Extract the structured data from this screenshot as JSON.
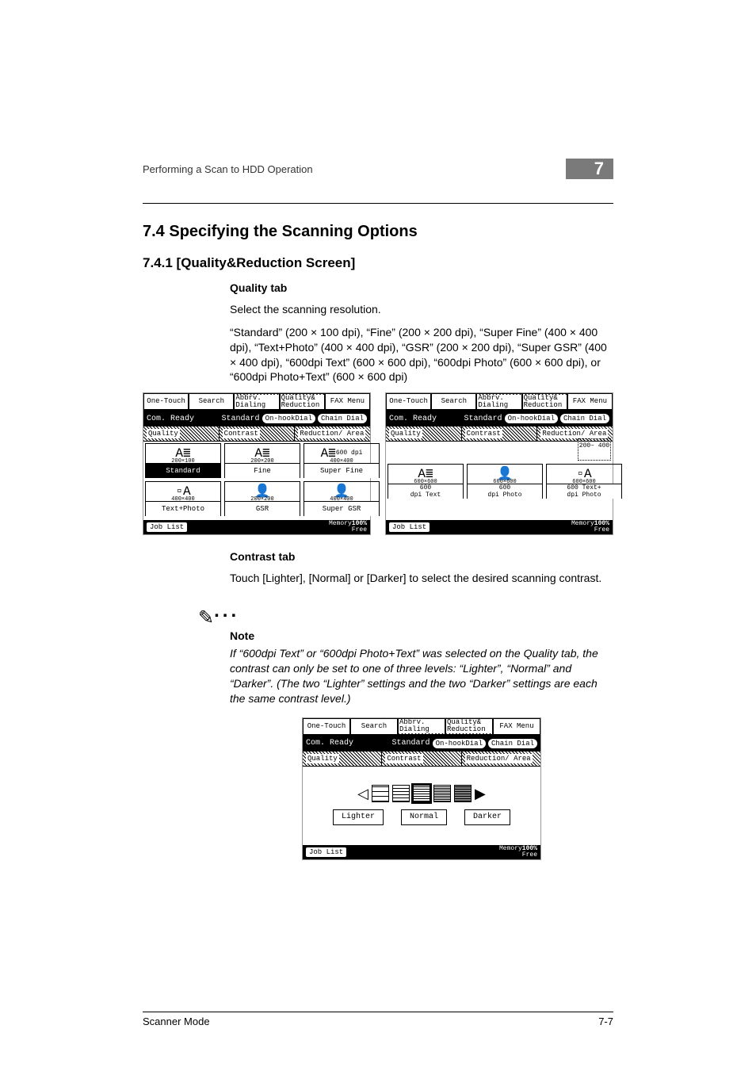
{
  "header": {
    "title": "Performing a Scan to HDD Operation",
    "chapter_number": "7"
  },
  "sec": {
    "number_title": "7.4    Specifying the Scanning Options",
    "sub_number_title": "7.4.1    [Quality&Reduction Screen]",
    "quality_head": "Quality tab",
    "quality_p1": "Select the scanning resolution.",
    "quality_p2": "“Standard” (200 × 100 dpi), “Fine” (200 × 200 dpi), “Super Fine” (400 × 400 dpi), “Text+Photo” (400 × 400 dpi), “GSR” (200 × 200 dpi), “Super GSR” (400 × 400 dpi), “600dpi Text” (600 × 600 dpi), “600dpi Photo” (600 × 600 dpi), or “600dpi Photo+Text” (600 × 600 dpi)",
    "contrast_head": "Contrast tab",
    "contrast_p1": "Touch [Lighter], [Normal] or [Darker] to select the desired scanning contrast.",
    "note_title": "Note",
    "note_body": "If “600dpi Text” or “600dpi Photo+Text” was selected on the Quality tab, the contrast can only be set to one of three levels: “Lighter”, “Normal” and “Darker”. (The two “Lighter” settings and the two “Darker” settings are each the same contrast level.)"
  },
  "lcd": {
    "tabs": {
      "one_touch": "One-Touch",
      "search": "Search",
      "abbrv": "Abbrv.\nDialing",
      "quality": "Quality&\nReduction",
      "fax_menu": "FAX Menu"
    },
    "status": {
      "ready": "Com. Ready",
      "standard": "Standard",
      "onhook": "On-hookDial",
      "chain": "Chain Dial"
    },
    "cols": {
      "quality": "Quality",
      "contrast": "Contrast",
      "reduction": "Reduction/\nArea"
    },
    "cells1": {
      "standard": "Standard",
      "standard_dpi": "200×100",
      "fine": "Fine",
      "fine_dpi": "200×200",
      "superfine": "Super Fine",
      "superfine_dpi": "400×400",
      "600dpi": "600\ndpi",
      "textphoto": "Text+Photo",
      "textphoto_dpi": "400×400",
      "gsr": "GSR",
      "gsr_dpi": "200×200",
      "supergsr": "Super GSR",
      "supergsr_dpi": "400×400"
    },
    "cells2": {
      "c1": "600×600",
      "c2": "600×600",
      "c3": "600×600",
      "t1": "600\ndpi Text",
      "t2": "600\ndpi Photo",
      "t3": "600   Text+\ndpi   Photo",
      "tag_200400": "200–\n400"
    },
    "contrast": {
      "lighter": "Lighter",
      "normal": "Normal",
      "darker": "Darker"
    },
    "bottom": {
      "joblist": "Job List",
      "memory": "Memory",
      "free": "Free",
      "pct": "100%"
    }
  },
  "footer": {
    "left": "Scanner Mode",
    "right": "7-7"
  }
}
